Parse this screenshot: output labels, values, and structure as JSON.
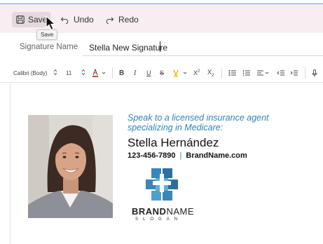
{
  "toolbar": {
    "save_label": "Save",
    "undo_label": "Undo",
    "redo_label": "Redo",
    "tooltip": "Save"
  },
  "signature_name": {
    "label": "Signature Name",
    "value": "Stella New Signature"
  },
  "format_bar": {
    "font_family": "Calibri (Body)",
    "font_size": "11",
    "font_color": "#d64541",
    "highlight_color": "#f2d019"
  },
  "signature": {
    "tagline": "Speak to a licensed insurance agent specializing in Medicare:",
    "name": "Stella Hernández",
    "phone": "123-456-7890",
    "separator": "|",
    "website": "BrandName.com",
    "brand_bold": "BRAND",
    "brand_regular": "NAME",
    "slogan": "SLOGAN",
    "accent_color": "#2f83b8"
  }
}
